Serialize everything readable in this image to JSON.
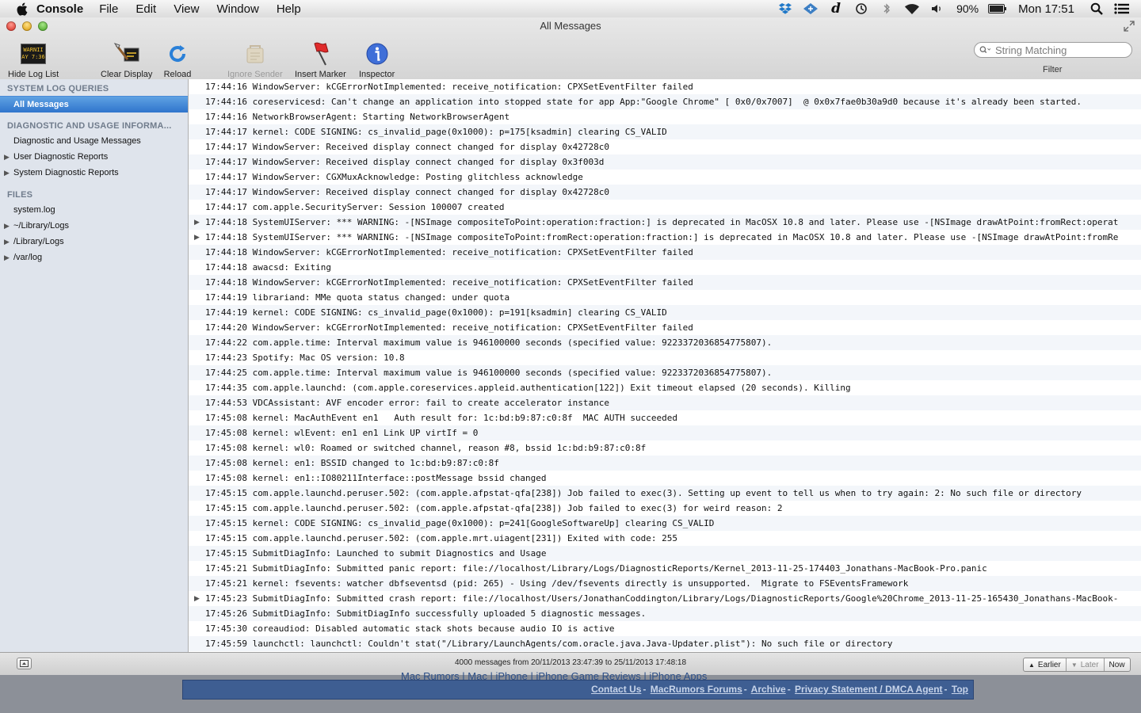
{
  "menubar": {
    "app_name": "Console",
    "menus": [
      "File",
      "Edit",
      "View",
      "Window",
      "Help"
    ],
    "battery": "90%",
    "clock": "Mon 17:51"
  },
  "window": {
    "title": "All Messages"
  },
  "toolbar": {
    "hide_log_list": "Hide Log List",
    "clear_display": "Clear Display",
    "reload": "Reload",
    "ignore_sender": "Ignore Sender",
    "insert_marker": "Insert Marker",
    "inspector": "Inspector",
    "search_placeholder": "String Matching",
    "filter_label": "Filter",
    "thumb_text_1": "WARNII",
    "thumb_text_2": "AY 7:36"
  },
  "sidebar": {
    "system_log_queries": "SYSTEM LOG QUERIES",
    "all_messages": "All Messages",
    "diagnostic_header": "DIAGNOSTIC AND USAGE INFORMA...",
    "diagnostic_messages": "Diagnostic and Usage Messages",
    "user_reports": "User Diagnostic Reports",
    "system_reports": "System Diagnostic Reports",
    "files_header": "FILES",
    "system_log": "system.log",
    "library_logs_user": "~/Library/Logs",
    "library_logs": "/Library/Logs",
    "var_log": "/var/log"
  },
  "log": {
    "rows": [
      {
        "text": "17:44:16 WindowServer: kCGErrorNotImplemented: receive_notification: CPXSetEventFilter failed",
        "expandable": false
      },
      {
        "text": "17:44:16 coreservicesd: Can't change an application into stopped state for app App:\"Google Chrome\" [ 0x0/0x7007]  @ 0x0x7fae0b30a9d0 because it's already been started.",
        "expandable": false
      },
      {
        "text": "17:44:16 NetworkBrowserAgent: Starting NetworkBrowserAgent",
        "expandable": false
      },
      {
        "text": "17:44:17 kernel: CODE SIGNING: cs_invalid_page(0x1000): p=175[ksadmin] clearing CS_VALID",
        "expandable": false
      },
      {
        "text": "17:44:17 WindowServer: Received display connect changed for display 0x42728c0",
        "expandable": false
      },
      {
        "text": "17:44:17 WindowServer: Received display connect changed for display 0x3f003d",
        "expandable": false
      },
      {
        "text": "17:44:17 WindowServer: CGXMuxAcknowledge: Posting glitchless acknowledge",
        "expandable": false
      },
      {
        "text": "17:44:17 WindowServer: Received display connect changed for display 0x42728c0",
        "expandable": false
      },
      {
        "text": "17:44:17 com.apple.SecurityServer: Session 100007 created",
        "expandable": false
      },
      {
        "text": "17:44:18 SystemUIServer: *** WARNING: -[NSImage compositeToPoint:operation:fraction:] is deprecated in MacOSX 10.8 and later. Please use -[NSImage drawAtPoint:fromRect:operat",
        "expandable": true
      },
      {
        "text": "17:44:18 SystemUIServer: *** WARNING: -[NSImage compositeToPoint:fromRect:operation:fraction:] is deprecated in MacOSX 10.8 and later. Please use -[NSImage drawAtPoint:fromRe",
        "expandable": true
      },
      {
        "text": "17:44:18 WindowServer: kCGErrorNotImplemented: receive_notification: CPXSetEventFilter failed",
        "expandable": false
      },
      {
        "text": "17:44:18 awacsd: Exiting",
        "expandable": false
      },
      {
        "text": "17:44:18 WindowServer: kCGErrorNotImplemented: receive_notification: CPXSetEventFilter failed",
        "expandable": false
      },
      {
        "text": "17:44:19 librariand: MMe quota status changed: under quota",
        "expandable": false
      },
      {
        "text": "17:44:19 kernel: CODE SIGNING: cs_invalid_page(0x1000): p=191[ksadmin] clearing CS_VALID",
        "expandable": false
      },
      {
        "text": "17:44:20 WindowServer: kCGErrorNotImplemented: receive_notification: CPXSetEventFilter failed",
        "expandable": false
      },
      {
        "text": "17:44:22 com.apple.time: Interval maximum value is 946100000 seconds (specified value: 9223372036854775807).",
        "expandable": false
      },
      {
        "text": "17:44:23 Spotify: Mac OS version: 10.8",
        "expandable": false
      },
      {
        "text": "17:44:25 com.apple.time: Interval maximum value is 946100000 seconds (specified value: 9223372036854775807).",
        "expandable": false
      },
      {
        "text": "17:44:35 com.apple.launchd: (com.apple.coreservices.appleid.authentication[122]) Exit timeout elapsed (20 seconds). Killing",
        "expandable": false
      },
      {
        "text": "17:44:53 VDCAssistant: AVF encoder error: fail to create accelerator instance",
        "expandable": false
      },
      {
        "text": "17:45:08 kernel: MacAuthEvent en1   Auth result for: 1c:bd:b9:87:c0:8f  MAC AUTH succeeded",
        "expandable": false
      },
      {
        "text": "17:45:08 kernel: wlEvent: en1 en1 Link UP virtIf = 0",
        "expandable": false
      },
      {
        "text": "17:45:08 kernel: wl0: Roamed or switched channel, reason #8, bssid 1c:bd:b9:87:c0:8f",
        "expandable": false
      },
      {
        "text": "17:45:08 kernel: en1: BSSID changed to 1c:bd:b9:87:c0:8f",
        "expandable": false
      },
      {
        "text": "17:45:08 kernel: en1::IO80211Interface::postMessage bssid changed",
        "expandable": false
      },
      {
        "text": "17:45:15 com.apple.launchd.peruser.502: (com.apple.afpstat-qfa[238]) Job failed to exec(3). Setting up event to tell us when to try again: 2: No such file or directory",
        "expandable": false
      },
      {
        "text": "17:45:15 com.apple.launchd.peruser.502: (com.apple.afpstat-qfa[238]) Job failed to exec(3) for weird reason: 2",
        "expandable": false
      },
      {
        "text": "17:45:15 kernel: CODE SIGNING: cs_invalid_page(0x1000): p=241[GoogleSoftwareUp] clearing CS_VALID",
        "expandable": false
      },
      {
        "text": "17:45:15 com.apple.launchd.peruser.502: (com.apple.mrt.uiagent[231]) Exited with code: 255",
        "expandable": false
      },
      {
        "text": "17:45:15 SubmitDiagInfo: Launched to submit Diagnostics and Usage",
        "expandable": false
      },
      {
        "text": "17:45:21 SubmitDiagInfo: Submitted panic report: file://localhost/Library/Logs/DiagnosticReports/Kernel_2013-11-25-174403_Jonathans-MacBook-Pro.panic",
        "expandable": false
      },
      {
        "text": "17:45:21 kernel: fsevents: watcher dbfseventsd (pid: 265) - Using /dev/fsevents directly is unsupported.  Migrate to FSEventsFramework",
        "expandable": false
      },
      {
        "text": "17:45:23 SubmitDiagInfo: Submitted crash report: file://localhost/Users/JonathanCoddington/Library/Logs/DiagnosticReports/Google%20Chrome_2013-11-25-165430_Jonathans-MacBook-",
        "expandable": true
      },
      {
        "text": "17:45:26 SubmitDiagInfo: SubmitDiagInfo successfully uploaded 5 diagnostic messages.",
        "expandable": false
      },
      {
        "text": "17:45:30 coreaudiod: Disabled automatic stack shots because audio IO is active",
        "expandable": false
      },
      {
        "text": "17:45:59 launchctl: launchctl: Couldn't stat(\"/Library/LaunchAgents/com.oracle.java.Java-Updater.plist\"): No such file or directory",
        "expandable": false
      }
    ]
  },
  "bottombar": {
    "status": "4000 messages from 20/11/2013 23:47:39 to 25/11/2013 17:48:18",
    "earlier": "Earlier",
    "later": "Later",
    "now": "Now"
  },
  "behind": {
    "nav_text": "Mac Rumors | Mac | iPhone | iPhone Game Reviews | iPhone Apps",
    "links": [
      "Contact Us",
      "MacRumors Forums",
      "Archive",
      "Privacy Statement / DMCA Agent",
      "Top"
    ]
  },
  "colors": {
    "selection": "#3a80d2",
    "sidebar_bg": "#dfe4ec",
    "footer_bar": "#3e5e92"
  }
}
